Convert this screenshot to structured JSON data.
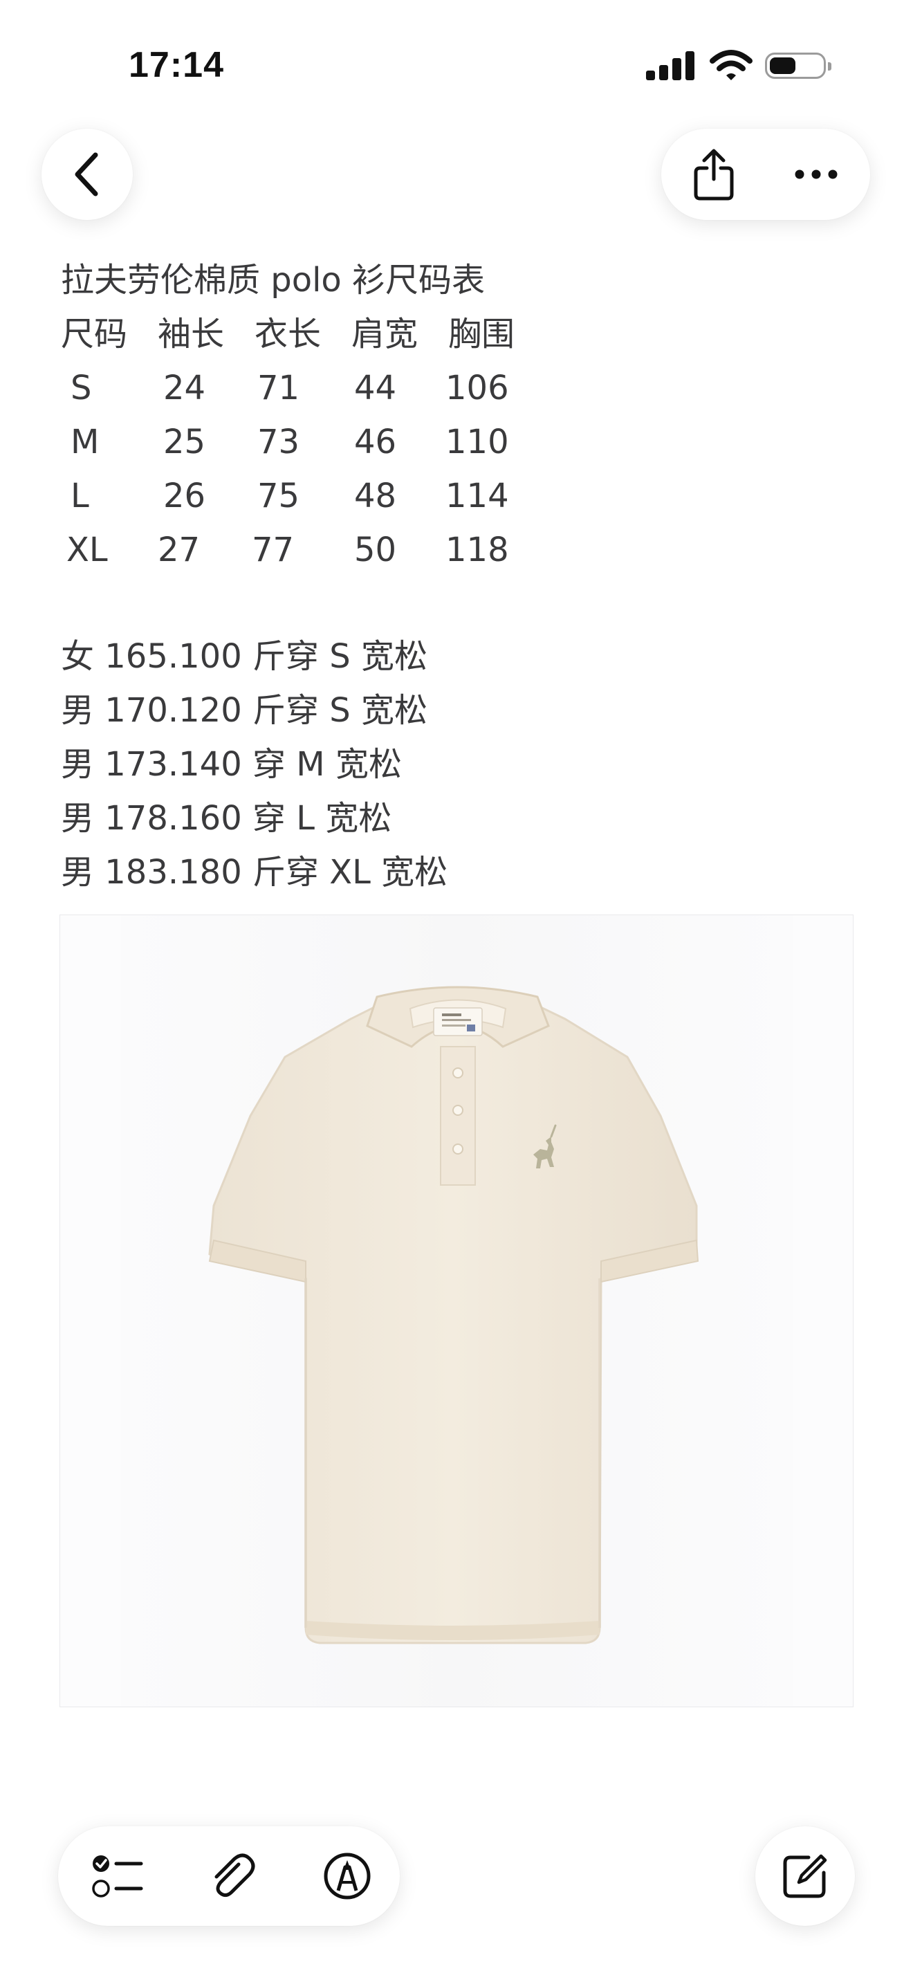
{
  "status_bar": {
    "time": "17:14",
    "battery_level": 0.5
  },
  "toolbar": {
    "back_icon": "chevron-left-icon",
    "share_icon": "share-icon",
    "more_icon": "more-horizontal-icon"
  },
  "note": {
    "title": "拉夫劳伦棉质 polo 衫尺码表",
    "table": {
      "headers": [
        "尺码",
        "袖长",
        "衣长",
        "肩宽",
        "胸围"
      ],
      "rows": [
        [
          "S",
          "24",
          "71",
          "44",
          "106"
        ],
        [
          "M",
          "25",
          "73",
          "46",
          "110"
        ],
        [
          "L",
          "26",
          "75",
          "48",
          "114"
        ],
        [
          "XL",
          "27",
          "77",
          "50",
          "118"
        ]
      ]
    },
    "recommendations": [
      "女 165.100 斤穿 S 宽松",
      "男 170.120 斤穿 S 宽松",
      "男 173.140 穿 M 宽松",
      "男 178.160 穿 L 宽松",
      "男 183.180 斤穿 XL 宽松"
    ],
    "image": {
      "subject": "cream polo shirt",
      "logo_icon": "polo-player-logo-icon"
    }
  },
  "bottom_toolbar": {
    "checklist_icon": "checklist-icon",
    "attachment_icon": "paperclip-icon",
    "markup_icon": "markup-pen-icon",
    "compose_icon": "compose-icon"
  },
  "colors": {
    "text": "#3a3a3c",
    "shirt": "#f1e9dc",
    "logo": "#b9b49a"
  }
}
